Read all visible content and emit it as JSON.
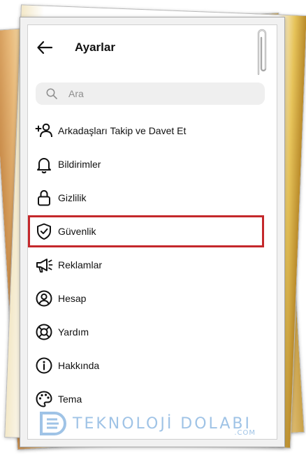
{
  "header": {
    "title": "Ayarlar",
    "back_icon": "arrow-left-icon"
  },
  "search": {
    "placeholder": "Ara",
    "value": ""
  },
  "menu": {
    "items": [
      {
        "label": "Arkadaşları Takip ve Davet Et",
        "icon": "add-person-icon"
      },
      {
        "label": "Bildirimler",
        "icon": "bell-icon"
      },
      {
        "label": "Gizlilik",
        "icon": "lock-icon"
      },
      {
        "label": "Güvenlik",
        "icon": "shield-check-icon",
        "highlighted": true
      },
      {
        "label": "Reklamlar",
        "icon": "megaphone-icon"
      },
      {
        "label": "Hesap",
        "icon": "profile-circle-icon"
      },
      {
        "label": "Yardım",
        "icon": "lifebuoy-icon"
      },
      {
        "label": "Hakkında",
        "icon": "info-icon"
      },
      {
        "label": "Tema",
        "icon": "palette-icon"
      }
    ]
  },
  "colors": {
    "highlight_border": "#c4282b",
    "search_bg": "#efefef",
    "watermark": "#9fc3e6"
  },
  "watermark": {
    "text": "TEKNOLOJİ DOLABI",
    "suffix": ".COM"
  }
}
